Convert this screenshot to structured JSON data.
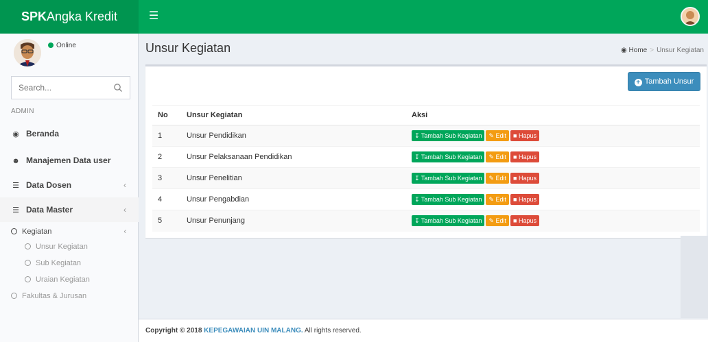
{
  "app": {
    "logo_bold": "SPK",
    "logo_rest": "Angka Kredit",
    "menu_icon": "hamburger-icon"
  },
  "sidebar": {
    "status": "Online",
    "search_placeholder": "Search...",
    "header": "ADMIN",
    "items": [
      {
        "label": "Beranda",
        "icon": "dashboard-icon"
      },
      {
        "label": "Manajemen Data user",
        "icon": "users-icon"
      },
      {
        "label": "Data Dosen",
        "icon": "list-icon"
      },
      {
        "label": "Data Master",
        "icon": "list-icon"
      }
    ],
    "kegiatan": "Kegiatan",
    "sub_items": [
      "Unsur Kegiatan",
      "Sub Kegiatan",
      "Uraian Kegiatan"
    ],
    "fakultas": "Fakultas & Jurusan"
  },
  "page": {
    "title": "Unsur Kegiatan",
    "breadcrumb_home": "Home",
    "breadcrumb_current": "Unsur Kegiatan",
    "add_button": "Tambah Unsur"
  },
  "table": {
    "headers": [
      "No",
      "Unsur Kegiatan",
      "Aksi"
    ],
    "rows": [
      {
        "no": "1",
        "name": "Unsur Pendidikan"
      },
      {
        "no": "2",
        "name": "Unsur Pelaksanaan Pendidikan"
      },
      {
        "no": "3",
        "name": "Unsur Penelitian"
      },
      {
        "no": "4",
        "name": "Unsur Pengabdian"
      },
      {
        "no": "5",
        "name": "Unsur Penunjang"
      }
    ],
    "actions": {
      "sub": "Tambah Sub Kegiatan",
      "edit": "Edit",
      "delete": "Hapus"
    }
  },
  "footer": {
    "copyright": "Copyright © 2018",
    "brand": "KEPEGAWAIAN UIN MALANG.",
    "rights": "All rights reserved."
  },
  "colors": {
    "header_green": "#00a65a",
    "primary_blue": "#3c8dbc",
    "warning": "#f39c12",
    "danger": "#dd4b39"
  }
}
